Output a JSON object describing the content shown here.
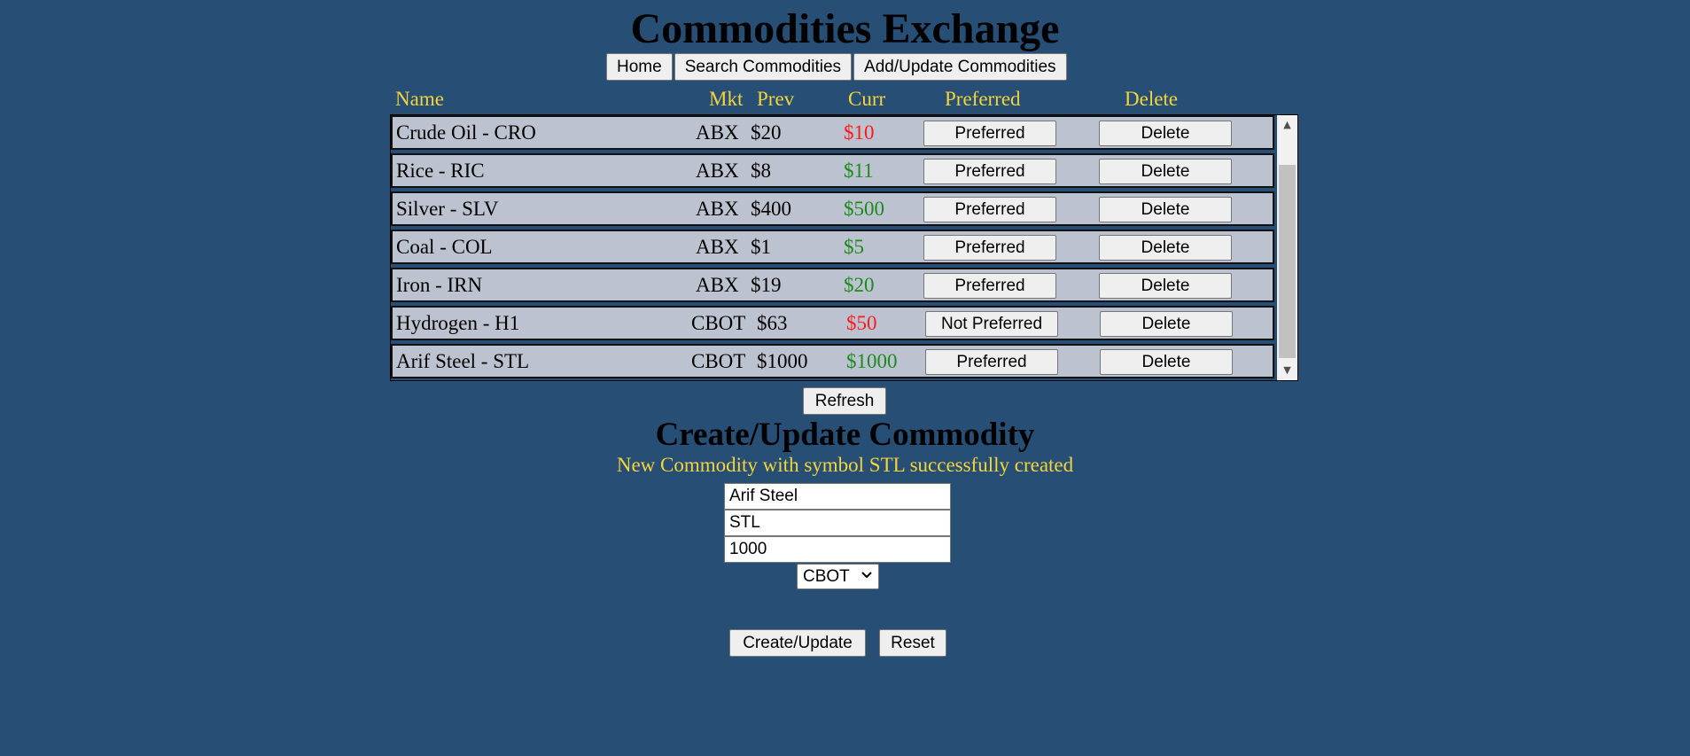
{
  "app": {
    "title": "Commodities Exchange"
  },
  "nav": {
    "home": "Home",
    "search": "Search Commodities",
    "add_update": "Add/Update Commodities"
  },
  "table": {
    "headers": {
      "name": "Name",
      "mkt": "Mkt",
      "prev": "Prev",
      "curr": "Curr",
      "preferred": "Preferred",
      "delete": "Delete"
    },
    "rows": [
      {
        "name": "Crude Oil - CRO",
        "mkt": "ABX",
        "prev": "$20",
        "curr": "$10",
        "trend": "down",
        "pref_label": "Preferred",
        "delete_label": "Delete"
      },
      {
        "name": "Rice - RIC",
        "mkt": "ABX",
        "prev": "$8",
        "curr": "$11",
        "trend": "up",
        "pref_label": "Preferred",
        "delete_label": "Delete"
      },
      {
        "name": "Silver - SLV",
        "mkt": "ABX",
        "prev": "$400",
        "curr": "$500",
        "trend": "up",
        "pref_label": "Preferred",
        "delete_label": "Delete"
      },
      {
        "name": "Coal - COL",
        "mkt": "ABX",
        "prev": "$1",
        "curr": "$5",
        "trend": "up",
        "pref_label": "Preferred",
        "delete_label": "Delete"
      },
      {
        "name": "Iron - IRN",
        "mkt": "ABX",
        "prev": "$19",
        "curr": "$20",
        "trend": "up",
        "pref_label": "Preferred",
        "delete_label": "Delete"
      },
      {
        "name": "Hydrogen - H1",
        "mkt": "CBOT",
        "prev": "$63",
        "curr": "$50",
        "trend": "down",
        "pref_label": "Not Preferred",
        "delete_label": "Delete"
      },
      {
        "name": "Arif Steel - STL",
        "mkt": "CBOT",
        "prev": "$1000",
        "curr": "$1000",
        "trend": "up",
        "pref_label": "Preferred",
        "delete_label": "Delete"
      }
    ],
    "refresh_label": "Refresh"
  },
  "colors": {
    "background": "#274f75",
    "accent_text": "#f5d33a",
    "up": "#1c8a1c",
    "down": "#ff1a1a",
    "row_bg": "#bcc2cf"
  },
  "form": {
    "title": "Create/Update Commodity",
    "message": "New Commodity with symbol STL successfully created",
    "name_value": "Arif Steel",
    "symbol_value": "STL",
    "price_value": "1000",
    "market_selected": "CBOT",
    "submit_label": "Create/Update",
    "reset_label": "Reset"
  }
}
